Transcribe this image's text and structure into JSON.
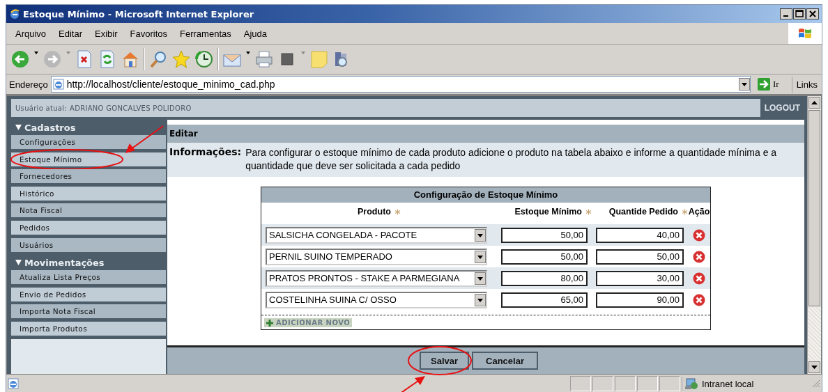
{
  "window": {
    "title": "Estoque Mínimo - Microsoft Internet Explorer"
  },
  "menu": [
    "Arquivo",
    "Editar",
    "Exibir",
    "Favoritos",
    "Ferramentas",
    "Ajuda"
  ],
  "address_bar": {
    "label": "Endereço",
    "url": "http://localhost/cliente/estoque_minimo_cad.php",
    "go": "Ir",
    "links": "Links"
  },
  "header": {
    "user_label": "Usuário atual:",
    "user_name": "ADRIANO GONCALVES POLIDORO",
    "logout": "LOGOUT"
  },
  "sidebar": [
    {
      "title": "Cadastros",
      "expanded": true,
      "items": [
        {
          "label": "Configurações",
          "annotated": false
        },
        {
          "label": "Estoque Mínimo",
          "annotated": true
        },
        {
          "label": "Fornecedores",
          "annotated": false
        },
        {
          "label": "Histórico",
          "annotated": false
        },
        {
          "label": "Nota Fiscal",
          "annotated": false
        },
        {
          "label": "Pedidos",
          "annotated": false
        },
        {
          "label": "Usuários",
          "annotated": false
        }
      ]
    },
    {
      "title": "Movimentações",
      "expanded": true,
      "items": [
        {
          "label": "Atualiza Lista Preços",
          "annotated": false
        },
        {
          "label": "Envio de Pedidos",
          "annotated": false
        },
        {
          "label": "Importa Nota Fiscal",
          "annotated": false
        },
        {
          "label": "Importa Produtos",
          "annotated": false
        }
      ]
    }
  ],
  "panel": {
    "title": "Editar",
    "info_label": "Informações:",
    "info_text": "Para configurar o estoque mínimo de cada produto adicione o produto na tabela abaixo e informe a quantidade mínima e a quantidade que deve ser solicitada a cada pedido"
  },
  "table": {
    "title": "Configuração de Estoque Mínimo",
    "columns": [
      {
        "label": "Produto",
        "required": true
      },
      {
        "label": "Estoque Mínimo",
        "required": true
      },
      {
        "label": "Quantide Pedido",
        "required": true
      },
      {
        "label": "Ação",
        "required": false
      }
    ],
    "rows": [
      {
        "product": "SALSICHA CONGELADA - PACOTE",
        "minimum": "50,00",
        "order_qty": "40,00"
      },
      {
        "product": "PERNIL SUINO TEMPERADO",
        "minimum": "50,00",
        "order_qty": "50,00"
      },
      {
        "product": "PRATOS PRONTOS - STAKE A PARMEGIANA",
        "minimum": "80,00",
        "order_qty": "30,00"
      },
      {
        "product": "COSTELINHA SUINA C/ OSSO",
        "minimum": "65,00",
        "order_qty": "90,00"
      }
    ],
    "add_label": "ADICIONAR NOVO"
  },
  "buttons": [
    {
      "label": "Salvar",
      "annotated": true
    },
    {
      "label": "Cancelar",
      "annotated": false
    }
  ],
  "status_bar": {
    "zone": "Intranet local"
  }
}
